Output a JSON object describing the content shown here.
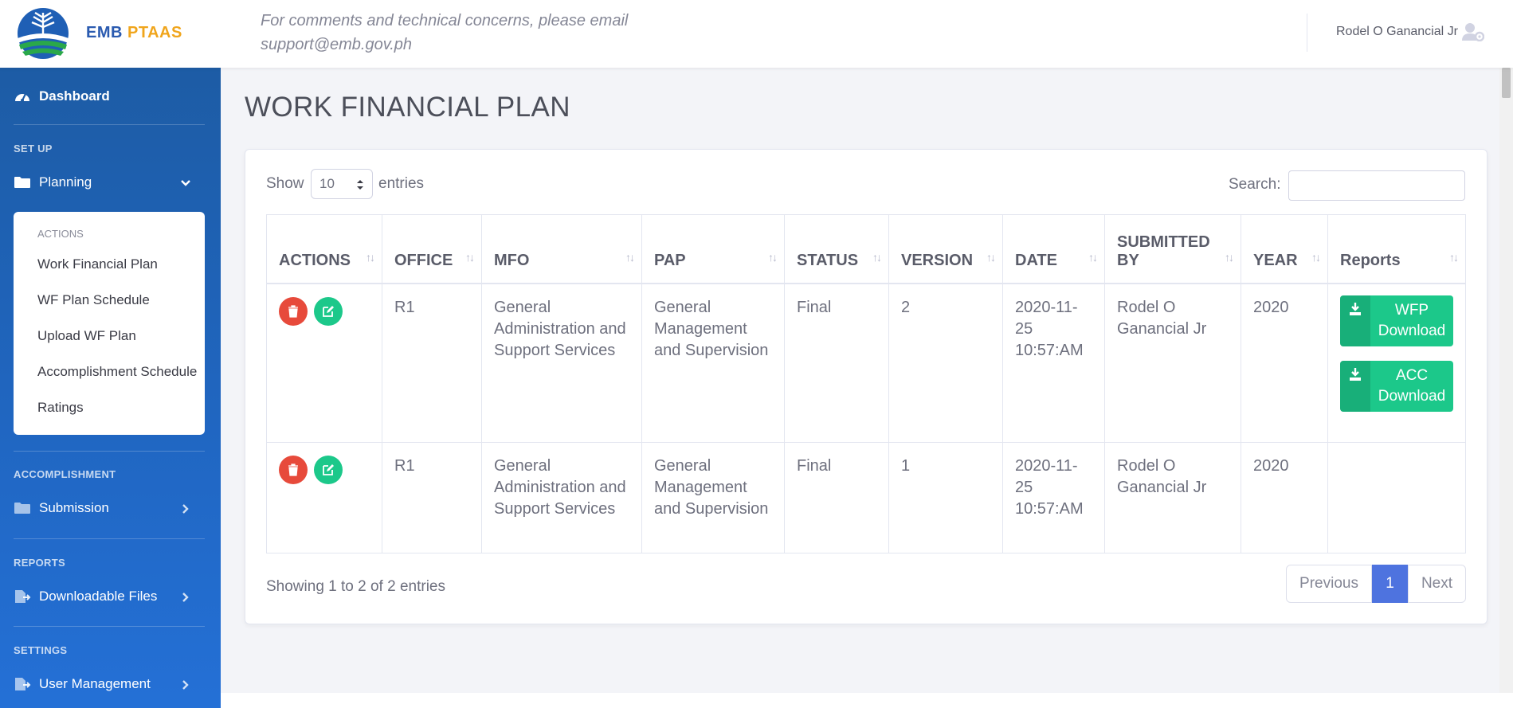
{
  "header": {
    "brand_part1": "EMB",
    "brand_part2": "PTAAS",
    "notice_line1": "For comments and technical concerns, please email",
    "notice_line2": "support@emb.gov.ph",
    "user_name": "Rodel O Ganancial Jr",
    "user_icon": "user-cog-icon"
  },
  "sidebar": {
    "dashboard": "Dashboard",
    "setup_heading": "SET UP",
    "planning": "Planning",
    "planning_submenu": {
      "heading": "ACTIONS",
      "items": [
        "Work Financial Plan",
        "WF Plan Schedule",
        "Upload WF Plan",
        "Accomplishment Schedule",
        "Ratings"
      ]
    },
    "accomplishment_heading": "ACCOMPLISHMENT",
    "submission": "Submission",
    "reports_heading": "REPORTS",
    "downloadable_files": "Downloadable Files",
    "settings_heading": "SETTINGS",
    "user_management": "User Management"
  },
  "page": {
    "title": "WORK FINANCIAL PLAN"
  },
  "table_controls": {
    "show_label": "Show",
    "entries_value": "10",
    "entries_label": "entries",
    "search_label": "Search:",
    "search_value": ""
  },
  "table": {
    "columns": [
      "ACTIONS",
      "OFFICE",
      "MFO",
      "PAP",
      "STATUS",
      "VERSION",
      "DATE",
      "SUBMITTED BY",
      "YEAR",
      "Reports"
    ],
    "rows": [
      {
        "office": "R1",
        "mfo": "General Administration and Support Services",
        "pap": "General Management and Supervision",
        "status": "Final",
        "version": "2",
        "date": "2020-11-25 10:57:AM",
        "submitted_by": "Rodel O Ganancial Jr",
        "year": "2020",
        "reports": [
          {
            "line1": "WFP",
            "line2": "Download"
          },
          {
            "line1": "ACC",
            "line2": "Download"
          }
        ]
      },
      {
        "office": "R1",
        "mfo": "General Administration and Support Services",
        "pap": "General Management and Supervision",
        "status": "Final",
        "version": "1",
        "date": "2020-11-25 10:57:AM",
        "submitted_by": "Rodel O Ganancial Jr",
        "year": "2020",
        "reports": []
      }
    ]
  },
  "footer": {
    "info": "Showing 1 to 2 of 2 entries",
    "previous": "Previous",
    "current_page": "1",
    "next": "Next"
  },
  "colors": {
    "sidebar": "#2066c1",
    "danger": "#e74a3b",
    "success": "#1cc88a",
    "primary": "#4e73df",
    "brand_blue": "#2b5bb0",
    "brand_orange": "#f0a51c"
  }
}
